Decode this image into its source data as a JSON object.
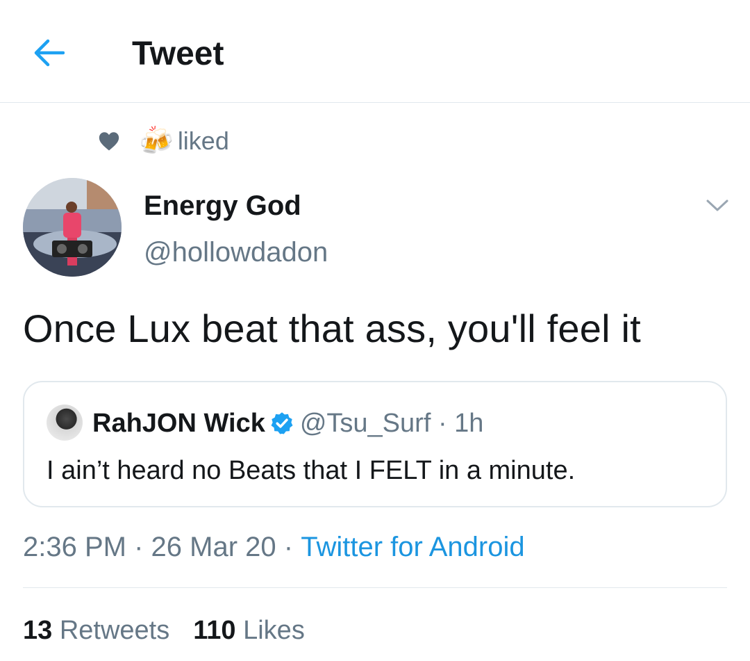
{
  "header": {
    "title": "Tweet",
    "back_icon": "arrow-left-icon",
    "accent_color": "#1da1f2"
  },
  "social_context": {
    "icon": "heart-icon",
    "emoji": "🍻",
    "text": "liked"
  },
  "tweet": {
    "author": {
      "display_name": "Energy God",
      "handle": "@hollowdadon"
    },
    "text": "Once Lux beat that ass, you'll feel it",
    "quoted": {
      "display_name": "RahJON Wick",
      "verified": true,
      "handle": "@Tsu_Surf",
      "separator": "·",
      "time_ago": "1h",
      "text": "I ain’t heard no Beats that I FELT in a minute."
    },
    "time": "2:36 PM",
    "date": "26 Mar 20",
    "dot": "·",
    "source": "Twitter for Android",
    "source_color": "#1b95e0"
  },
  "stats": {
    "retweets_count": "13",
    "retweets_label": "Retweets",
    "likes_count": "110",
    "likes_label": "Likes"
  }
}
